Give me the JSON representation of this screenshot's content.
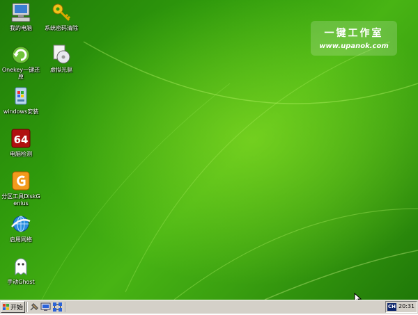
{
  "desktop_icons": [
    {
      "label": "我的电脑",
      "icon": "computer-icon"
    },
    {
      "label": "系统密码清除",
      "icon": "key-icon"
    },
    {
      "label": "Onekey一键还原",
      "icon": "restore-icon"
    },
    {
      "label": "虚拟光驱",
      "icon": "virtual-cd-icon"
    },
    {
      "label": "windows安装",
      "icon": "windows-install-icon"
    },
    {
      "label": "电脑检测",
      "icon": "aida64-icon"
    },
    {
      "label": "分区工具DiskGenius",
      "icon": "diskgenius-icon"
    },
    {
      "label": "启用网络",
      "icon": "network-globe-icon"
    },
    {
      "label": "手动Ghost",
      "icon": "ghost-icon"
    }
  ],
  "watermark": {
    "title": "一键工作室",
    "url": "www.upanok.com"
  },
  "taskbar": {
    "start_label": "开始",
    "quick_launch": [
      "tool-icon",
      "monitor-icon",
      "network-icon"
    ],
    "lang": "CH",
    "clock": "20:31"
  },
  "colors": {
    "desktop": "#2f9a0c",
    "taskbar": "#d4d0c8",
    "lang_bg": "#0a246a"
  }
}
